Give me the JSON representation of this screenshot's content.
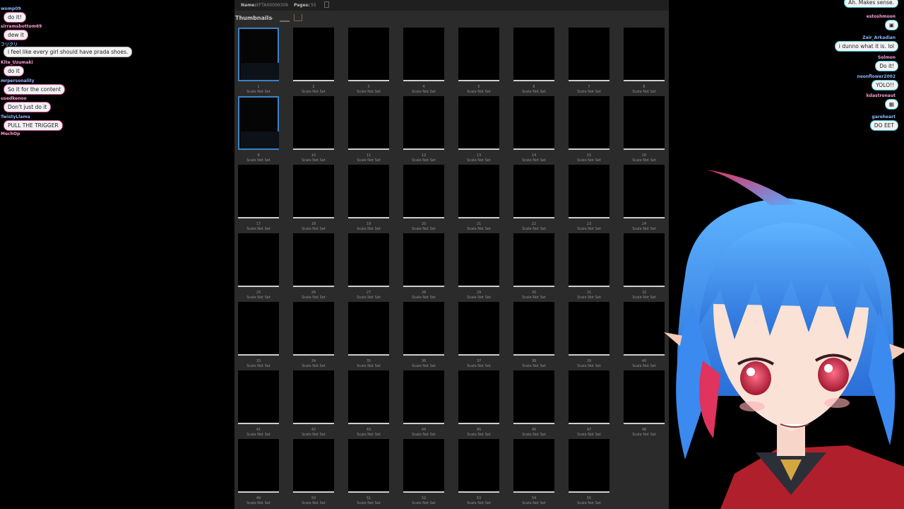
{
  "viewer": {
    "name_label": "Name:",
    "name_value": "EFTA00006309",
    "pages_label": "Pages:",
    "pages_value": "55",
    "panel_title": "Thumbnails",
    "chevron": "⌄"
  },
  "thumbnails": {
    "caption": "Scale Not Set",
    "pages": [
      "1",
      "2",
      "3",
      "4",
      "5",
      "6",
      "7",
      "8",
      "9",
      "10",
      "11",
      "12",
      "13",
      "14",
      "15",
      "16",
      "17",
      "18",
      "19",
      "20",
      "21",
      "22",
      "23",
      "24",
      "25",
      "26",
      "27",
      "28",
      "29",
      "30",
      "31",
      "32",
      "33",
      "34",
      "35",
      "36",
      "37",
      "38",
      "39",
      "40",
      "41",
      "42",
      "43",
      "44",
      "45",
      "46",
      "47",
      "48",
      "49",
      "50",
      "51",
      "52",
      "53",
      "54",
      "55"
    ]
  },
  "chat_left": [
    {
      "user": "",
      "message": ""
    },
    {
      "user": "womp09",
      "message": "do it!"
    },
    {
      "user": "sirramsbottom69",
      "message": "dew it"
    },
    {
      "user": "フリクリ",
      "message": "i feel like every girl should have prada shoes."
    },
    {
      "user": "Kite_Uzumaki",
      "message": "do it"
    },
    {
      "user": "mrpersonality",
      "message": "So it for the content"
    },
    {
      "user": "usedkenoo",
      "message": "Don't just do it"
    },
    {
      "user": "TwistyLlama",
      "message": "PULL THE TRIGGER"
    },
    {
      "user": "MechOp",
      "message": ""
    }
  ],
  "chat_right": [
    {
      "user": "",
      "message": "Ah. Makes sense."
    },
    {
      "user": "estoshmoon",
      "message": "▣"
    },
    {
      "user": "Zair_Arkadian",
      "message": "i dunno what it is. lol"
    },
    {
      "user": "Solmon",
      "message": "Do it!"
    },
    {
      "user": "neonflower2002",
      "message": "YOLO!!"
    },
    {
      "user": "kdastronaut",
      "message": "▦"
    },
    {
      "user": "gareheart",
      "message": "DO EET"
    }
  ],
  "colors": {
    "accent": "#3b82c4",
    "panel": "#2b2b2b",
    "hair": "#3d8ef0",
    "eyes": "#d61f3f"
  }
}
